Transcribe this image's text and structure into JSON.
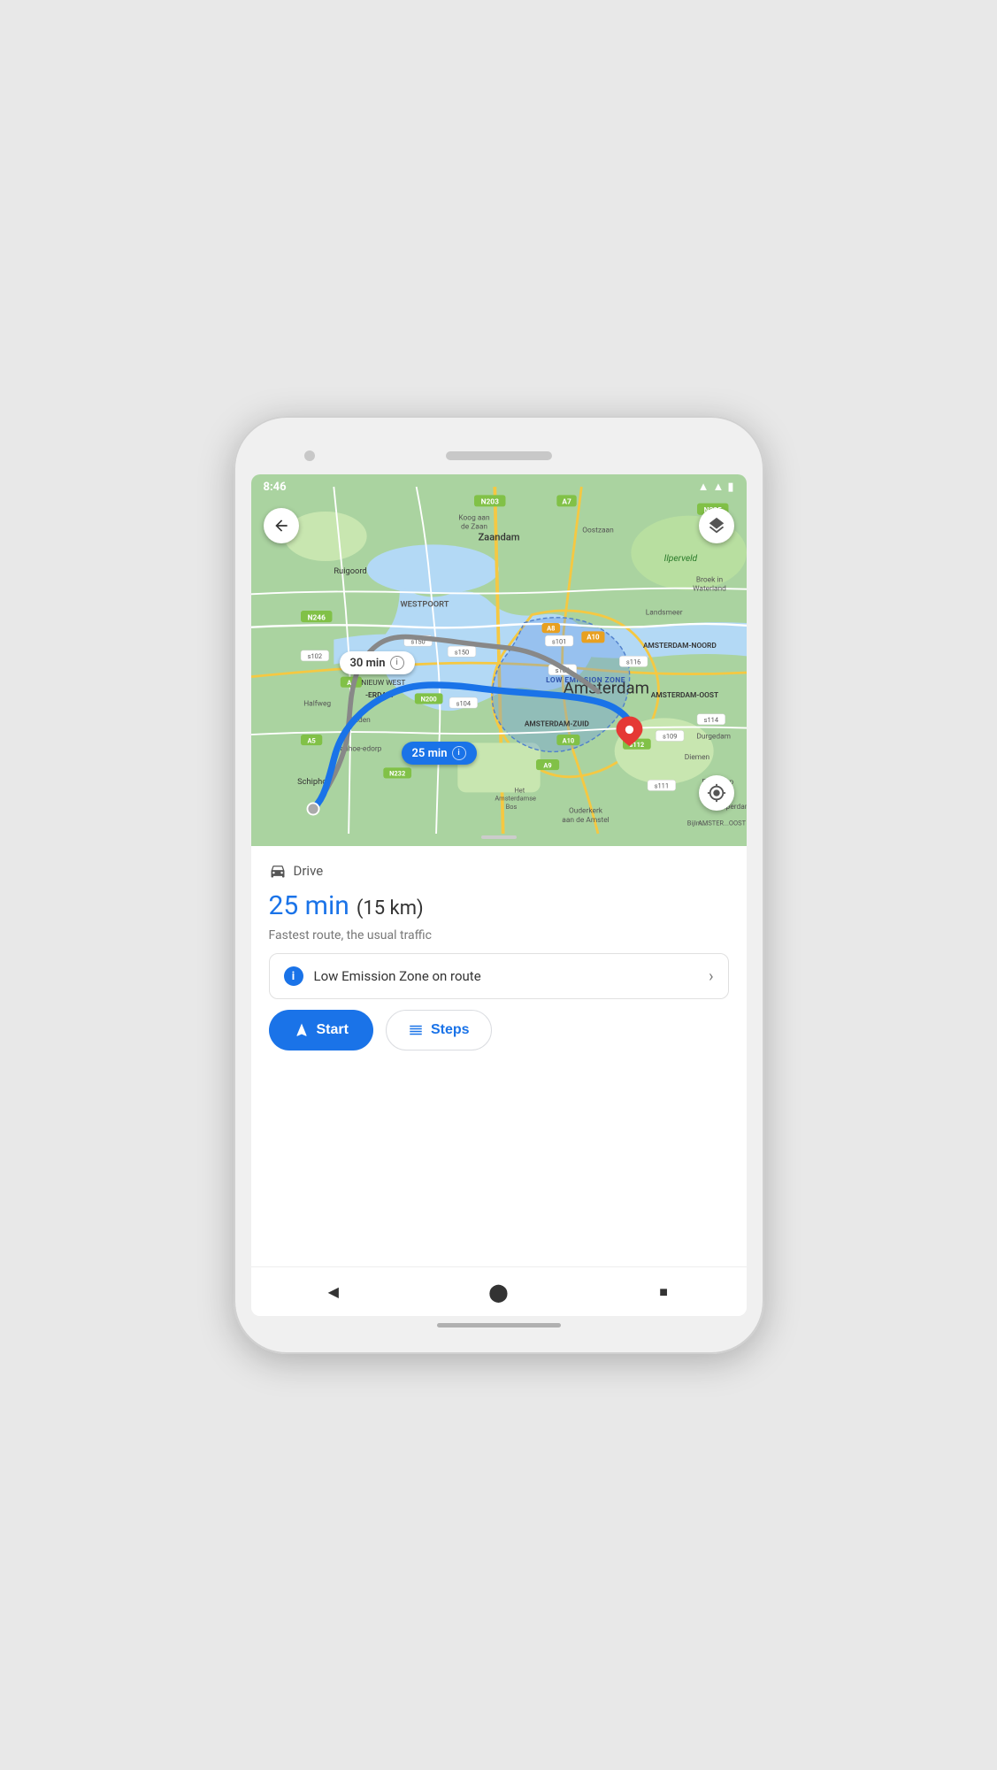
{
  "status_bar": {
    "time": "8:46",
    "wifi": "wifi",
    "signal": "signal",
    "battery": "battery"
  },
  "map": {
    "back_button_label": "←",
    "layers_button_label": "layers",
    "location_button_label": "◎",
    "route_time_main": "25 min",
    "route_time_alt": "30 min",
    "info_icon": "ℹ",
    "low_emission_label": "LOW EMISSION ZONE"
  },
  "bottom_panel": {
    "drive_label": "Drive",
    "route_time": "25 min",
    "route_distance": "(15 km)",
    "route_description": "Fastest route, the usual traffic",
    "lez_text": "Low Emission Zone on route",
    "start_label": "Start",
    "steps_label": "Steps"
  },
  "nav_bar": {
    "back_label": "◀",
    "home_label": "⬤",
    "square_label": "■"
  }
}
